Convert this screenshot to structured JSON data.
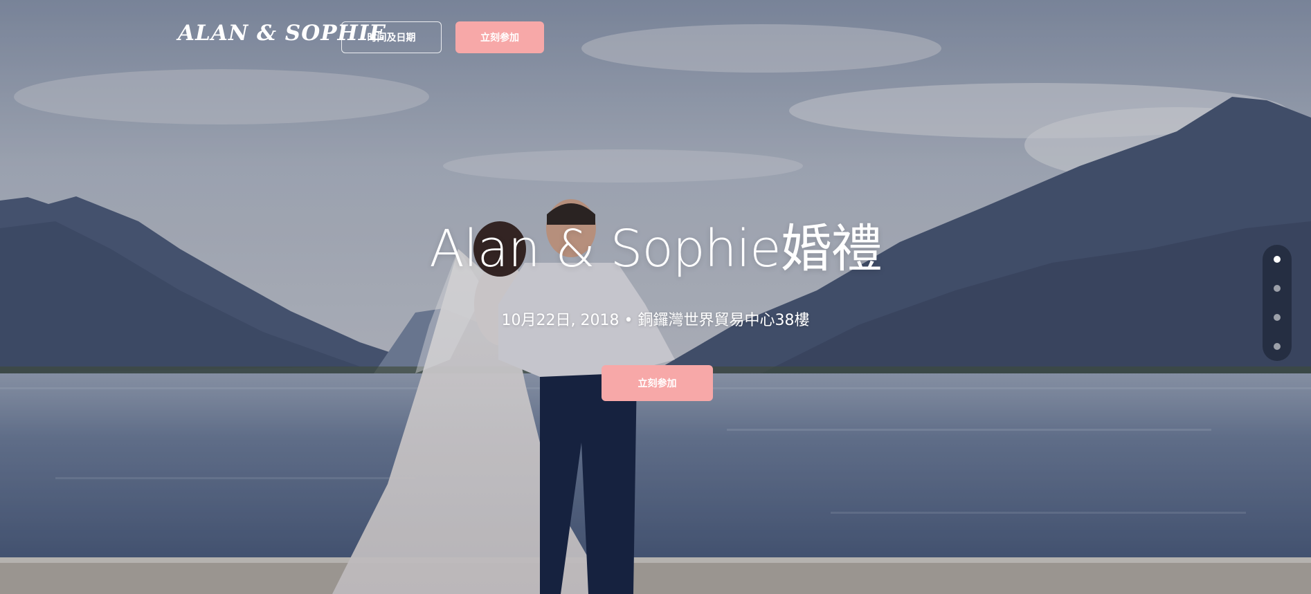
{
  "brand": {
    "logo_text": "ALAN & SOPHIE"
  },
  "nav": {
    "time_date_label": "时间及日期",
    "join_label": "立刻参加"
  },
  "hero": {
    "title": "Alan & Sophie婚禮",
    "subtitle": "10月22日, 2018 • 銅鑼灣世界貿易中心38樓",
    "cta_label": "立刻参加",
    "background_icon": "wedding-couple-lake-photo"
  },
  "pager": {
    "count": 4,
    "active_index": 0
  },
  "colors": {
    "accent": "#f7a8a8",
    "text": "#ffffff",
    "pager_bg": "#161e2c"
  }
}
